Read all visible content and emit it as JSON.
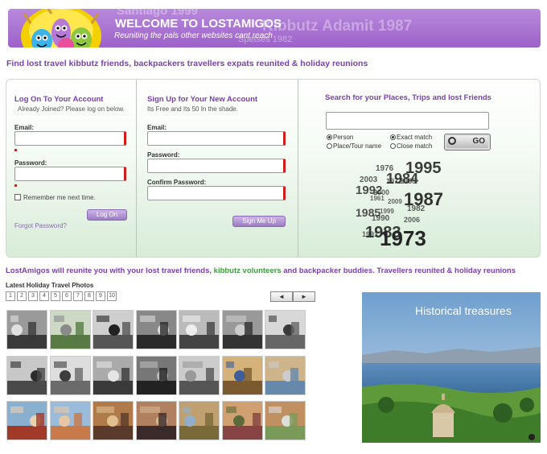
{
  "header": {
    "ghost_top": "Santiago 1999",
    "ghost_mid": "Kibbutz Adamit 1987",
    "ghost_bottom": "Spetses 1982",
    "welcome": "WELCOME TO LOSTAMIGOS",
    "tagline": "Reuniting the pals other websites cant reach"
  },
  "subheading": "Find lost travel kibbutz friends, backpackers travellers expats reunited & holiday reunions",
  "login": {
    "title": "Log On To Your Account",
    "subtitle": "Already Joined? Please log on below.",
    "email_label": "Email:",
    "password_label": "Password:",
    "remember_label": "Remember me next time.",
    "button": "Log On",
    "forgot_link": "Forgot Password?"
  },
  "signup": {
    "title": "Sign Up for Your New Account",
    "subtitle": "Its Free and Its 50 In the shade.",
    "email_label": "Email:",
    "password_label": "Password:",
    "confirm_label": "Confirm Password:",
    "button": "Sign Me Up"
  },
  "search": {
    "title": "Search for your Places, Trips and lost Friends",
    "option_person": "Person",
    "option_place": "Place/Tour name",
    "option_exact": "Exact match",
    "option_close": "Close match",
    "go_label": "GO",
    "selected_type": "Person",
    "selected_match": "Exact match"
  },
  "year_cloud": [
    "1976",
    "1984",
    "1995",
    "2003",
    "1992",
    "1987",
    "2009",
    "1985",
    "1999",
    "1982",
    "1990",
    "2006",
    "1983",
    "1973",
    "1991",
    "1977",
    "1961",
    "1965",
    "2000"
  ],
  "intro": {
    "part1": "LostAmigos will reunite you with your lost travel friends,",
    "part2": "kibbutz volunteers",
    "part3": "and backpacker buddies.",
    "part4": "Travellers reunited & holiday reunions"
  },
  "gallery": {
    "title": "Latest Holiday Travel Photos",
    "pages": [
      "1",
      "2",
      "3",
      "4",
      "5",
      "6",
      "7",
      "8",
      "9",
      "10"
    ],
    "prev": "◄",
    "next": "►"
  },
  "feature": {
    "caption": "Historical treasures"
  }
}
